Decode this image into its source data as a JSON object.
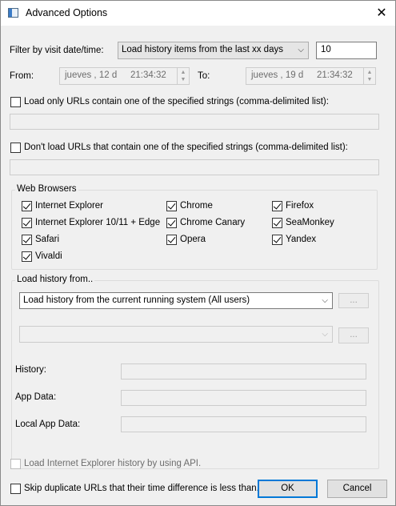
{
  "window": {
    "title": "Advanced Options",
    "close_glyph": "✕"
  },
  "filter": {
    "label": "Filter by visit date/time:",
    "mode_value": "Load history items from the last xx days",
    "days_value": "10"
  },
  "range": {
    "from_label": "From:",
    "from_date": "jueves  , 12 d",
    "from_time": "21:34:32",
    "to_label": "To:",
    "to_date": "jueves  , 19 d",
    "to_time": "21:34:32"
  },
  "include_urls": {
    "label": "Load only URLs contain one of the specified strings (comma-delimited list):",
    "checked": false,
    "value": ""
  },
  "exclude_urls": {
    "label": "Don't load URLs that contain one of the specified strings (comma-delimited list):",
    "checked": false,
    "value": ""
  },
  "browsers": {
    "title": "Web Browsers",
    "items": [
      {
        "label": "Internet Explorer",
        "checked": true
      },
      {
        "label": "Chrome",
        "checked": true
      },
      {
        "label": "Firefox",
        "checked": true
      },
      {
        "label": "Internet Explorer 10/11 + Edge",
        "checked": true
      },
      {
        "label": "Chrome Canary",
        "checked": true
      },
      {
        "label": "SeaMonkey",
        "checked": true
      },
      {
        "label": "Safari",
        "checked": true
      },
      {
        "label": "Opera",
        "checked": true
      },
      {
        "label": "Yandex",
        "checked": true
      },
      {
        "label": "Vivaldi",
        "checked": true
      }
    ]
  },
  "load_from": {
    "title": "Load history from..",
    "source_value": "Load history from the current running system (All users)",
    "browse_label": "...",
    "profile_value": "",
    "browse2_label": "...",
    "history_label": "History:",
    "app_data_label": "App Data:",
    "local_app_data_label": "Local App Data:"
  },
  "ie_api": {
    "label": "Load Internet Explorer history by using API.",
    "checked": false,
    "enabled": false
  },
  "skip_dup": {
    "label": "Skip duplicate URLs that their time difference is less than...",
    "checked": false
  },
  "buttons": {
    "ok": "OK",
    "cancel": "Cancel"
  },
  "colors": {
    "accent": "#0078d7",
    "window_bg": "#f0f0f0"
  },
  "icons": {
    "combo_arrow": "⌵",
    "spin_up": "▲",
    "spin_down": "▼"
  }
}
